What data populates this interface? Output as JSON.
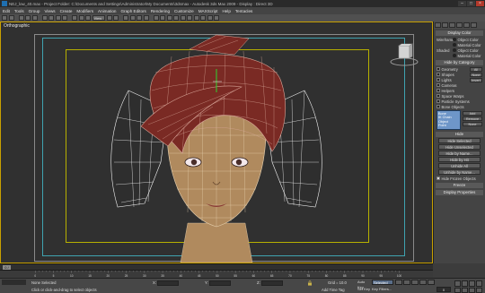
{
  "window": {
    "title": "NEJ_low_40.max - Project Folder: C:\\Documents and Settings\\Administrator\\My Documents\\3dsmax - Autodesk 3ds Max 2009 - Display : Direct 3D"
  },
  "menu": [
    "Edit",
    "Tools",
    "Group",
    "Views",
    "Create",
    "Modifiers",
    "Animation",
    "Graph Editors",
    "Rendering",
    "Customize",
    "MAXScript",
    "Help",
    "Tentacles"
  ],
  "toolbar": {
    "ref_coord": "View"
  },
  "viewport": {
    "label": "Orthographic"
  },
  "command_panel": {
    "display_color_header": "Display Color",
    "wireframe_label": "Wireframe",
    "shaded_label": "Shaded",
    "object_color": "Object Color",
    "material_color": "Material Color",
    "hide_by_category_header": "Hide by Category",
    "categories": [
      {
        "label": "Geometry",
        "btn": "All"
      },
      {
        "label": "Shapes",
        "btn": "None"
      },
      {
        "label": "Lights",
        "btn": "Invert"
      },
      {
        "label": "Cameras",
        "btn": ""
      },
      {
        "label": "Helpers",
        "btn": ""
      },
      {
        "label": "Space Warps",
        "btn": ""
      },
      {
        "label": "Particle Systems",
        "btn": ""
      },
      {
        "label": "Bone Objects",
        "btn": ""
      }
    ],
    "bone_list": [
      "Bone",
      "IK Chain Object",
      "Point"
    ],
    "bone_buttons": [
      "Add",
      "Remove",
      "None"
    ],
    "hide_header": "Hide",
    "hide_buttons": [
      "Hide Selected",
      "Hide Unselected",
      "Hide by Name...",
      "Hide by Hit"
    ],
    "unhide_buttons": [
      "Unhide All",
      "Unhide by Name..."
    ],
    "hide_frozen_label": "Hide Frozen Objects",
    "freeze_header": "Freeze",
    "display_properties_header": "Display Properties"
  },
  "timeline": {
    "frame_display": "0 / 100",
    "ticks": [
      0,
      5,
      10,
      15,
      20,
      25,
      30,
      35,
      40,
      45,
      50,
      55,
      60,
      65,
      70,
      75,
      80,
      85,
      90,
      95,
      100
    ]
  },
  "status": {
    "selection": "None Selected",
    "prompt": "Click or click-and-drag to select objects",
    "x_label": "X:",
    "y_label": "Y:",
    "z_label": "Z:",
    "grid": "Grid = 10.0",
    "add_time_tag": "Add Time Tag",
    "auto_key": "Auto Key",
    "set_key": "Set Key",
    "selected_dropdown": "Selected",
    "key_filters": "Key Filters...",
    "frame_field": "0"
  },
  "colors": {
    "hair_fill": "#7a2a24",
    "hair_wire": "#d9a79a",
    "skin": "#b08a5e",
    "wire_white": "#f2f2f2",
    "viewport_bg": "#303030",
    "active_border": "#c8a000",
    "safe_frame_teal": "#3fa3b0",
    "safe_frame_yellow": "#b7b000"
  }
}
